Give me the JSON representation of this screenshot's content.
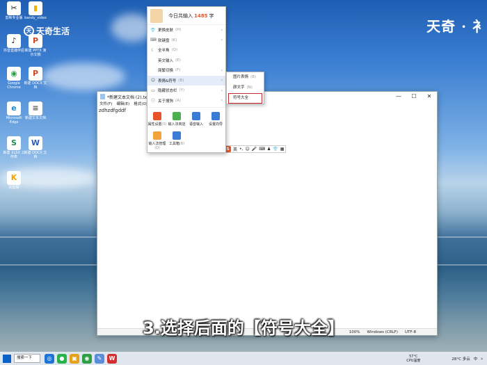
{
  "watermark": {
    "site": "天奇 · 衤",
    "brand": "天奇生活"
  },
  "desktop_icons": [
    {
      "label": "剪映专业版",
      "glyph": "✂",
      "color": "#111111"
    },
    {
      "label": "bandy_video",
      "glyph": "▮",
      "color": "#f0b400"
    },
    {
      "label": "抖音直播伴侣",
      "glyph": "♪",
      "color": "#111111"
    },
    {
      "label": "新建 PPTX 演示文稿",
      "glyph": "P",
      "color": "#d24726"
    },
    {
      "label": "Google Chrome",
      "glyph": "◉",
      "color": "#2f9e44"
    },
    {
      "label": "新建 DOCX 文档",
      "glyph": "P",
      "color": "#d24726"
    },
    {
      "label": "Microsoft Edge",
      "glyph": "e",
      "color": "#1c8ad6"
    },
    {
      "label": "新建文本文档",
      "glyph": "≡",
      "color": "#ffffff"
    },
    {
      "label": "新建 XLSX 工作表",
      "glyph": "S",
      "color": "#1f8f4e"
    },
    {
      "label": "新建 DOCX 文档",
      "glyph": "W",
      "color": "#2b5cb8"
    },
    {
      "label": "快剪辑",
      "glyph": "K",
      "color": "#f5a400"
    }
  ],
  "notepad": {
    "title": "*新建文本文档 (2).txt - 记",
    "menu": [
      "文件(F)",
      "编辑(E)",
      "格式(O)"
    ],
    "content": "zdhzdfgddf",
    "status": [
      "100%",
      "Windows (CRLF)",
      "UTF-8"
    ],
    "controls": [
      "—",
      "☐",
      "✕"
    ]
  },
  "ime_menu": {
    "header_prefix": "今日共输入",
    "count": "1485",
    "header_suffix": "字",
    "items": [
      {
        "icon": "👕",
        "label": "更换皮肤",
        "key": "(H)",
        "arrow": "›"
      },
      {
        "icon": "⌨",
        "label": "软键盘",
        "key": "(K)",
        "arrow": "›"
      },
      {
        "icon": "☾",
        "label": "全半角",
        "key": "(Q)",
        "arrow": ""
      },
      {
        "icon": "",
        "label": "英文输入",
        "key": "(E)",
        "arrow": ""
      },
      {
        "icon": "",
        "label": "简繁切换",
        "key": "(F)",
        "arrow": "›"
      },
      {
        "icon": "☺",
        "label": "表情&符号",
        "key": "(B)",
        "arrow": "›",
        "active": true
      },
      {
        "icon": "▭",
        "label": "隐藏状态栏",
        "key": "(Y)",
        "arrow": "›"
      },
      {
        "icon": "ⓘ",
        "label": "关于搜狗",
        "key": "(A)",
        "arrow": "›"
      }
    ],
    "grid": [
      {
        "label": "属性设置",
        "key": "(S)",
        "color": "#e8542a"
      },
      {
        "label": "输入法商店",
        "key": "",
        "color": "#4caf50"
      },
      {
        "label": "语音输入",
        "key": "",
        "color": "#3a7bd5"
      },
      {
        "label": "设置向导",
        "key": "",
        "color": "#3a7bd5"
      },
      {
        "label": "输入法管理",
        "key": "(O)",
        "color": "#f2a33a"
      },
      {
        "label": "工具箱",
        "key": "(B)",
        "color": "#3a7bd5"
      }
    ]
  },
  "submenu": [
    {
      "label": "图片表情",
      "key": "(B)"
    },
    {
      "label": "颜文字",
      "key": "(N)"
    },
    {
      "label": "符号大全",
      "key": "",
      "highlight": true
    }
  ],
  "ime_bar": {
    "logo": "S",
    "mode": "英",
    "glyphs": [
      "•,",
      "☺",
      "🎤",
      "⌨",
      "♟",
      "👕",
      "▦"
    ]
  },
  "caption": "3.选择后面的【符号大全】",
  "taskbar": {
    "search": "搜索一下",
    "apps": [
      {
        "glyph": "◎",
        "color": "#1b74d8"
      },
      {
        "glyph": "●",
        "color": "#2bb34b"
      },
      {
        "glyph": "▣",
        "color": "#e3a21a"
      },
      {
        "glyph": "◉",
        "color": "#2f9e44"
      },
      {
        "glyph": "✎",
        "color": "#5b8dd9"
      },
      {
        "glyph": "W",
        "color": "#d32f2f"
      }
    ],
    "cpu_temp": "57°C",
    "cpu_label": "CPU温度",
    "weather": "28°C 多云",
    "ime_indicator": "中"
  }
}
